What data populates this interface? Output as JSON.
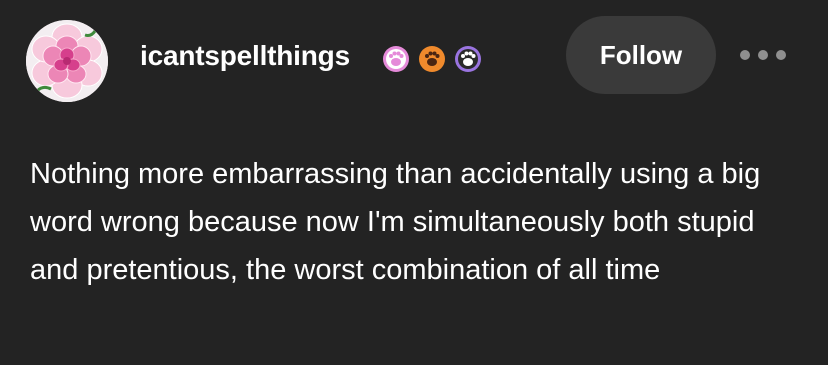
{
  "post": {
    "author": {
      "username": "icantspellthings",
      "badges": [
        {
          "icon": "pink-paw-badge-icon",
          "color": "#e58ad9"
        },
        {
          "icon": "orange-paw-badge-icon",
          "color": "#f08a2c"
        },
        {
          "icon": "purple-paw-badge-icon",
          "color": "#9a74e0"
        }
      ]
    },
    "follow_label": "Follow",
    "more_icon": "more-options-icon",
    "body": "Nothing more embarrassing than accidentally using a big word wrong because now I'm simultaneously both stupid and pretentious, the worst combination of all time"
  },
  "colors": {
    "background": "#232323",
    "button_bg": "#3a3a3a",
    "text": "#ffffff",
    "muted": "#8f8f8f"
  }
}
